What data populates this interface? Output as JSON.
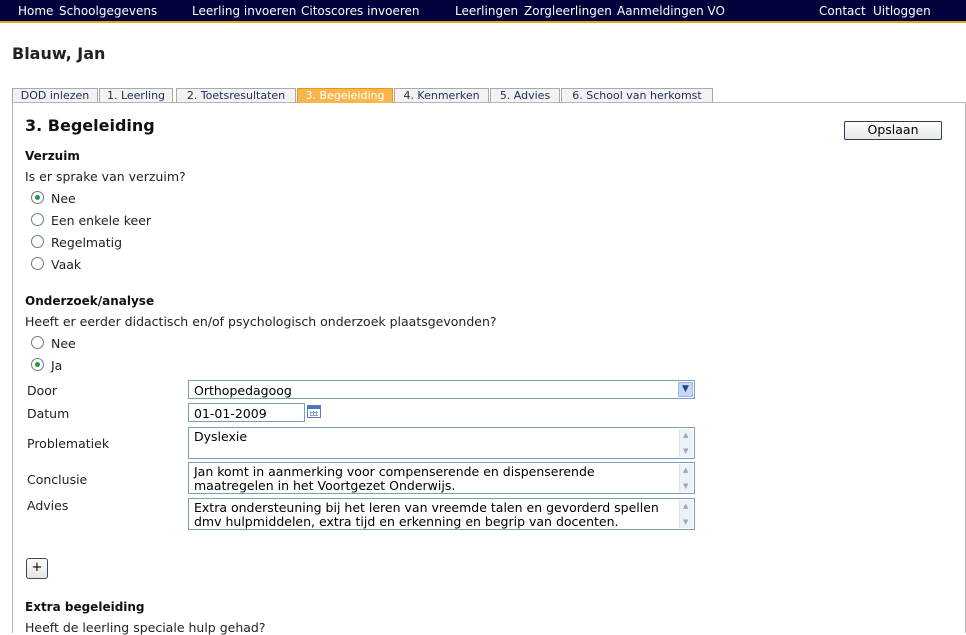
{
  "topnav": {
    "items": [
      "Home",
      "Schoolgegevens",
      "Leerling invoeren",
      "Citoscores invoeren",
      "Leerlingen",
      "Zorgleerlingen",
      "Aanmeldingen VO",
      "Contact",
      "Uitloggen"
    ]
  },
  "person": {
    "name": "Blauw, Jan"
  },
  "tabs": [
    "DOD inlezen",
    "1. Leerling",
    "2. Toetsresultaten",
    "3. Begeleiding",
    "4. Kenmerken",
    "5. Advies",
    "6. School van herkomst"
  ],
  "section": {
    "title": "3. Begeleiding",
    "save_label": "Opslaan"
  },
  "verzuim": {
    "heading": "Verzuim",
    "question": "Is er sprake van verzuim?",
    "options": [
      "Nee",
      "Een enkele keer",
      "Regelmatig",
      "Vaak"
    ],
    "selected": "Nee"
  },
  "onderzoek": {
    "heading": "Onderzoek/analyse",
    "question": "Heeft er eerder didactisch en/of psychologisch onderzoek plaatsgevonden?",
    "options": [
      "Nee",
      "Ja"
    ],
    "selected": "Ja",
    "door_label": "Door",
    "door_value": "Orthopedagoog",
    "datum_label": "Datum",
    "datum_value": "01-01-2009",
    "problematiek_label": "Problematiek",
    "problematiek_value": "Dyslexie",
    "conclusie_label": "Conclusie",
    "conclusie_value": "Jan komt in aanmerking voor compenserende en dispenserende maatregelen in het Voortgezet Onderwijs.",
    "advies_label": "Advies",
    "advies_value": "Extra ondersteuning bij het leren van vreemde talen en gevorderd spellen dmv hulpmiddelen, extra tijd en erkenning en begrip van docenten.",
    "add_label": "+"
  },
  "extra": {
    "heading": "Extra begeleiding",
    "question": "Heeft de leerling speciale hulp gehad?"
  },
  "colors": {
    "nav_bg": "#01013c",
    "nav_accent": "#e8a21c",
    "active_tab": "#fab64c",
    "radio_dot": "#1f9e3a"
  }
}
